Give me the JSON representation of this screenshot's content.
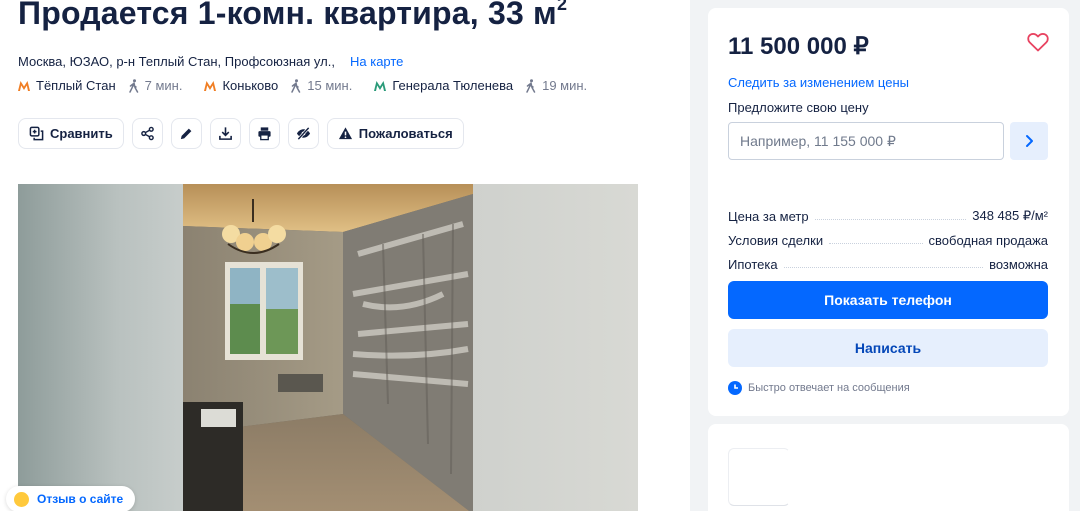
{
  "header": {
    "title": "Продается 1-комн. квартира, 33 м",
    "title_sup": "2",
    "address": "Москва, ЮЗАО, р-н Теплый Стан, Профсоюзная ул.,",
    "map_link": "На карте"
  },
  "metro": [
    {
      "station": "Тёплый Стан",
      "walk": "7 мин.",
      "color": "#f07e24"
    },
    {
      "station": "Коньково",
      "walk": "15 мин.",
      "color": "#f07e24"
    },
    {
      "station": "Генерала Тюленева",
      "walk": "19 мин.",
      "color": "#2a9b79"
    }
  ],
  "toolbar": {
    "compare": "Сравнить",
    "report": "Пожаловаться"
  },
  "feedback": "Отзыв о сайте",
  "card": {
    "price": "11 500 000 ₽",
    "track_price": "Следить за изменением цены",
    "offer_label": "Предложите свою цену",
    "offer_placeholder": "Например, 11 155 000 ₽",
    "rows": [
      {
        "label": "Цена за метр",
        "value": "348 485 ₽/м²"
      },
      {
        "label": "Условия сделки",
        "value": "свободная продажа"
      },
      {
        "label": "Ипотека",
        "value": "возможна"
      }
    ],
    "phone_button": "Показать телефон",
    "write_button": "Написать",
    "fast_reply": "Быстро отвечает на сообщения"
  },
  "colors": {
    "accent": "#0468ff",
    "accent_light": "#e6effd",
    "text": "#152242",
    "muted": "#737a8e"
  }
}
